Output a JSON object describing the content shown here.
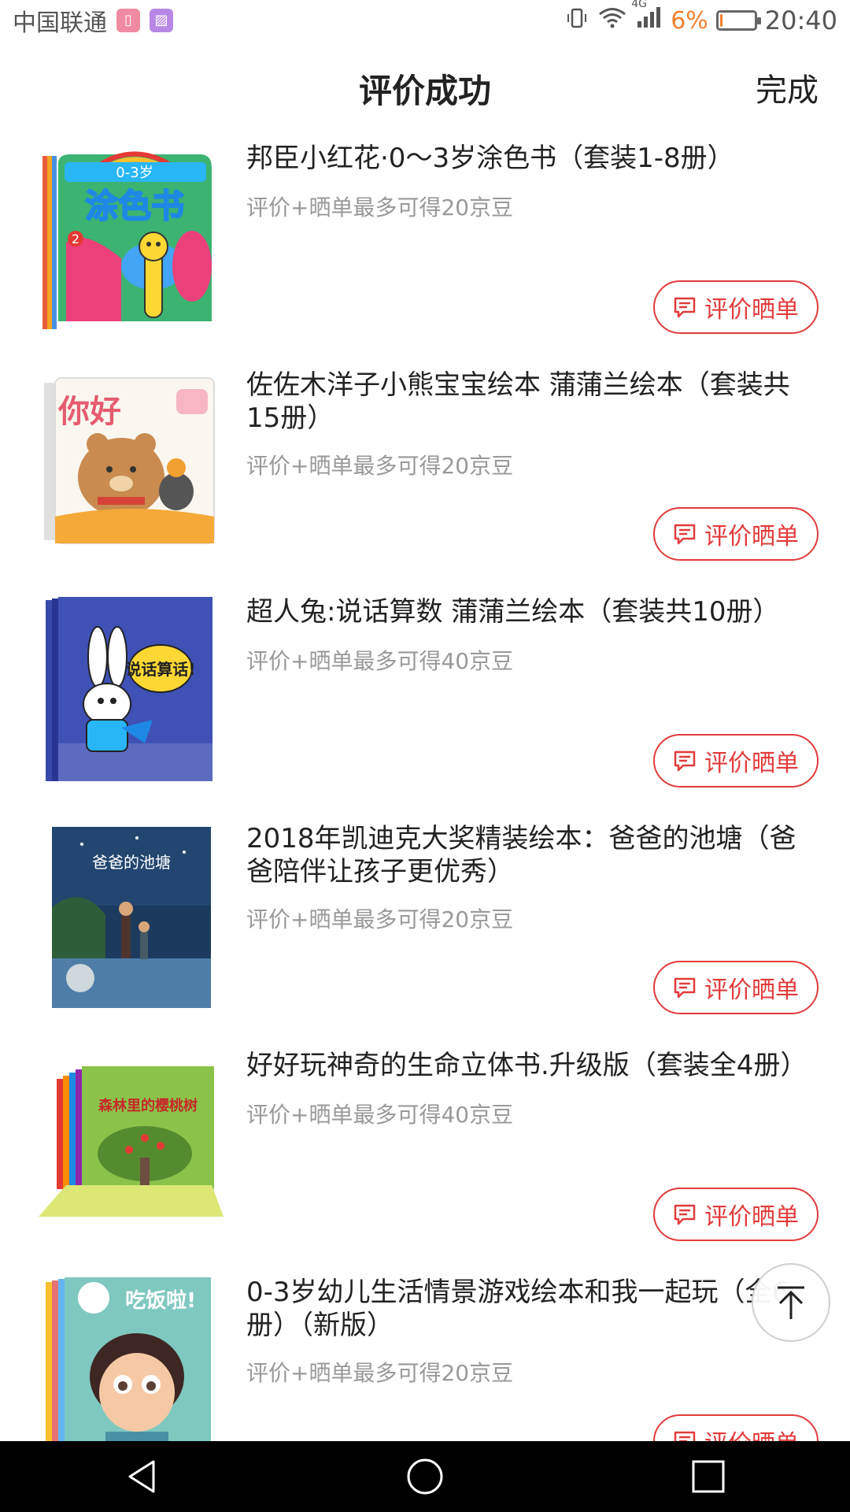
{
  "status_bar": {
    "carrier": "中国联通",
    "network": "4G",
    "battery_percent": "6%",
    "battery_level": 0.06,
    "time": "20:40"
  },
  "header": {
    "title": "评价成功",
    "done_label": "完成"
  },
  "items": [
    {
      "title": "邦臣小红花·0～3岁涂色书（套装1-8册）",
      "subtitle": "评价+晒单最多可得20京豆",
      "button_label": "评价晒单",
      "cover_text": "涂色书",
      "cover_top_text": "0-3岁"
    },
    {
      "title": "佐佐木洋子小熊宝宝绘本 蒲蒲兰绘本（套装共15册）",
      "subtitle": "评价+晒单最多可得20京豆",
      "button_label": "评价晒单",
      "cover_text": "你好"
    },
    {
      "title": "超人兔:说话算数 蒲蒲兰绘本（套装共10册）",
      "subtitle": "评价+晒单最多可得40京豆",
      "button_label": "评价晒单",
      "cover_text": "说话算话!"
    },
    {
      "title": "2018年凯迪克大奖精装绘本：爸爸的池塘（爸爸陪伴让孩子更优秀）",
      "subtitle": "评价+晒单最多可得20京豆",
      "button_label": "评价晒单",
      "cover_text": "爸爸的池塘"
    },
    {
      "title": "好好玩神奇的生命立体书.升级版（套装全4册）",
      "subtitle": "评价+晒单最多可得40京豆",
      "button_label": "评价晒单",
      "cover_text": "森林里的樱桃树"
    },
    {
      "title": "0-3岁幼儿生活情景游戏绘本和我一起玩（全6册）（新版）",
      "subtitle": "评价+晒单最多可得20京豆",
      "button_label": "评价晒单",
      "cover_text": "吃饭啦!"
    }
  ],
  "colors": {
    "accent": "#e23b3b",
    "subtitle": "#999999",
    "battery_low": "#f08030"
  },
  "icons": {
    "review": "chat-bubble-icon",
    "back_top": "arrow-up-icon",
    "nav": [
      "back-triangle-icon",
      "home-circle-icon",
      "recent-square-icon"
    ]
  }
}
